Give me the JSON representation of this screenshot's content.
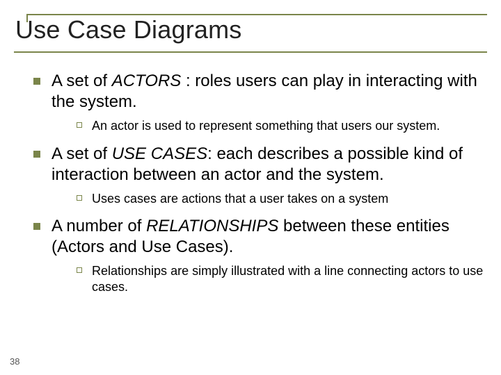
{
  "title": "Use Case Diagrams",
  "items": [
    {
      "pre": "A set of ",
      "em": "ACTORS",
      "post": " : roles users can play in interacting with the system.",
      "sub": "An actor is used to represent something that users our system."
    },
    {
      "pre": "A set of ",
      "em": "USE CASES",
      "post": ": each describes a possible kind of interaction between an actor and the system.",
      "sub": "Uses cases are actions that a user takes on a system"
    },
    {
      "pre": "A number of ",
      "em": "RELATIONSHIPS",
      "post": " between these entities (Actors and Use Cases).",
      "sub": "Relationships are simply illustrated with a line connecting actors to use cases."
    }
  ],
  "page": "38"
}
